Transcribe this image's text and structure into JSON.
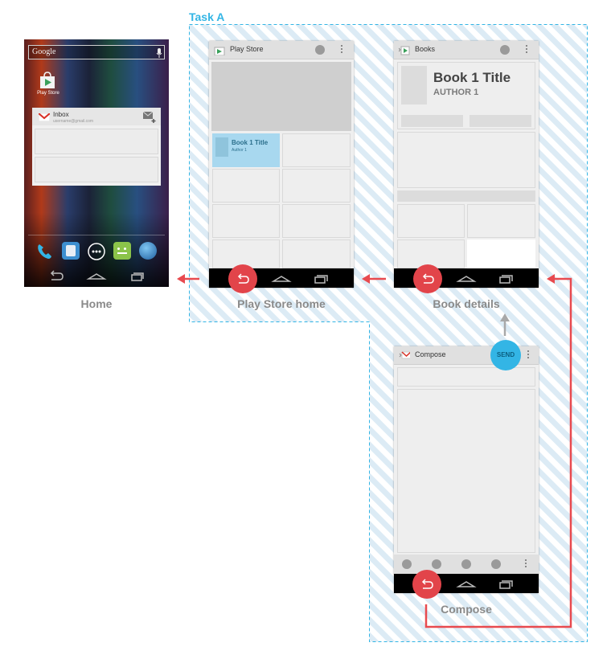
{
  "task": {
    "label": "Task A"
  },
  "colors": {
    "accent_blue": "#33b5e5",
    "back_red": "#e2444a",
    "arrow_red": "#e84a4f",
    "arrow_grey": "#a8a8a8"
  },
  "home": {
    "search_label": "Google",
    "app_icon_label": "Play Store",
    "widget_title": "Inbox",
    "widget_subtitle": "username@gmail.com",
    "caption": "Home"
  },
  "play_store": {
    "title": "Play Store",
    "card_title": "Book 1 Title",
    "card_author": "Author 1",
    "caption": "Play Store home"
  },
  "book_details": {
    "title": "Books",
    "book_title": "Book 1 Title",
    "book_author": "AUTHOR 1",
    "caption": "Book details"
  },
  "compose": {
    "title": "Compose",
    "send_label": "SEND",
    "caption": "Compose"
  }
}
